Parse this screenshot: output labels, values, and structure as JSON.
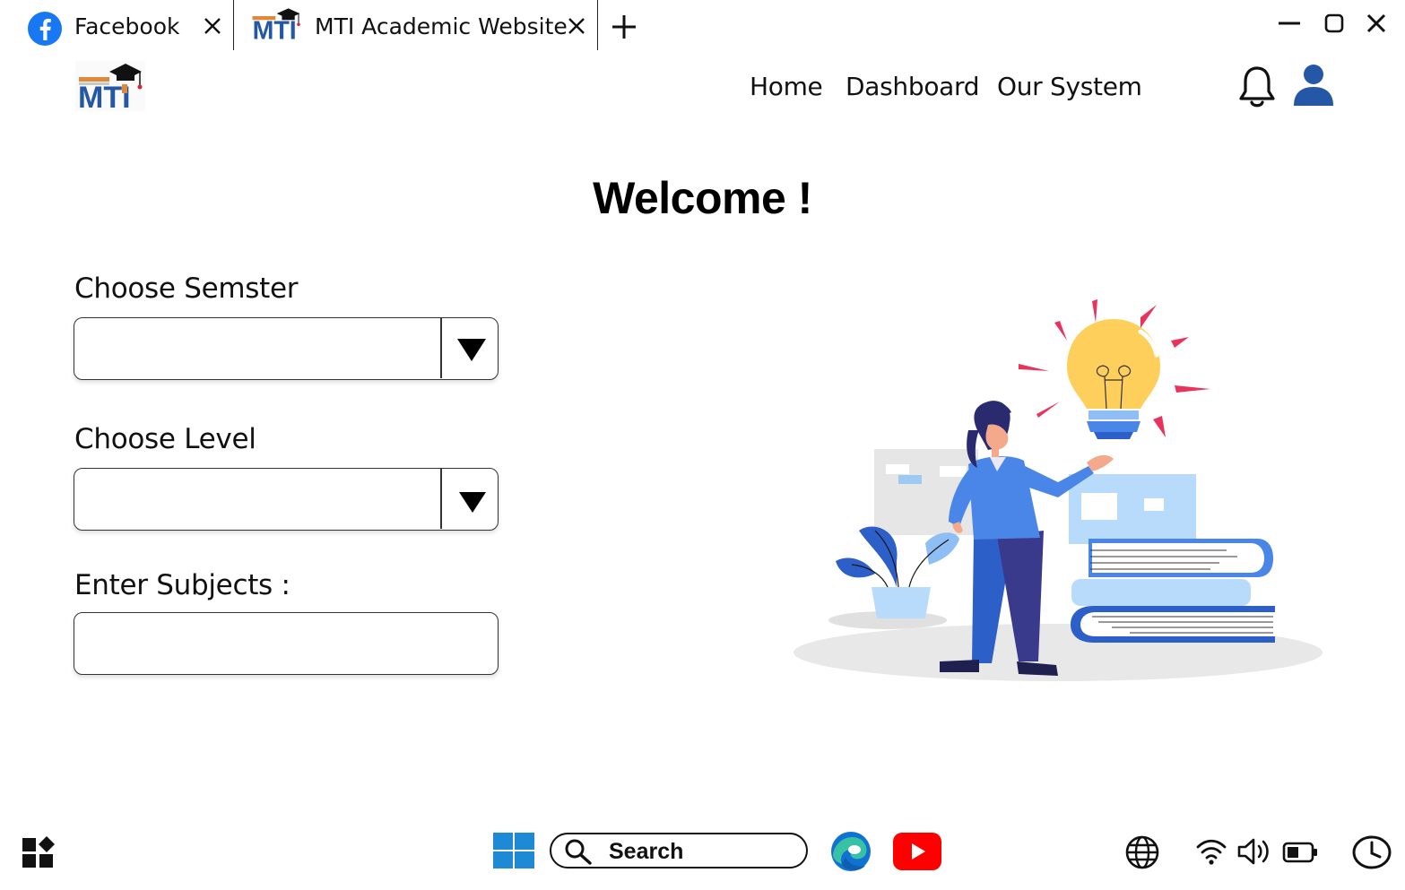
{
  "tabs": [
    {
      "label": "Facebook",
      "icon": "facebook-icon",
      "active": false
    },
    {
      "label": "MTI Academic Website",
      "icon": "mti-logo-icon",
      "active": true
    }
  ],
  "window_controls": [
    "minimize-icon",
    "maximize-icon",
    "close-icon"
  ],
  "site": {
    "logo_icon": "mti-logo-icon",
    "nav": [
      "Home",
      "Dashboard",
      "Our System"
    ],
    "notification_icon": "bell-icon",
    "profile_icon": "user-icon"
  },
  "main": {
    "heading": "Welcome !",
    "semester": {
      "label": "Choose Semster",
      "value": ""
    },
    "level": {
      "label": "Choose Level",
      "value": ""
    },
    "subjects": {
      "label": "Enter Subjects :",
      "value": "",
      "placeholder": ""
    },
    "illustration": "woman-with-lightbulb-and-books-illustration"
  },
  "taskbar": {
    "widgets_icon": "widgets-icon",
    "start_icon": "windows-start-icon",
    "search_label": "Search",
    "apps": [
      "edge-icon",
      "youtube-icon"
    ],
    "tray": [
      "globe-icon",
      "wifi-icon",
      "volume-icon",
      "battery-icon",
      "clock-icon"
    ]
  },
  "colors": {
    "brand_blue": "#2557a7",
    "facebook_blue": "#1877f2",
    "youtube_red": "#ff0000",
    "windows_blue": "#1e8ad6"
  }
}
